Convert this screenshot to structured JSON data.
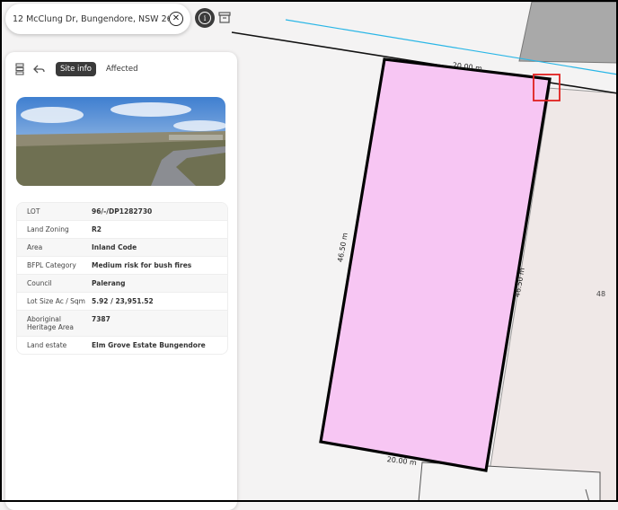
{
  "search": {
    "address": "12 McClung Dr, Bungendore, NSW 2621, A..."
  },
  "panel": {
    "tabs": [
      {
        "label": "Site info",
        "active": true
      },
      {
        "label": "Affected",
        "active": false
      }
    ],
    "rows": [
      {
        "label": "LOT",
        "value": "96/-/DP1282730"
      },
      {
        "label": "Land Zoning",
        "value": "R2"
      },
      {
        "label": "Area",
        "value": "Inland Code"
      },
      {
        "label": "BFPL Category",
        "value": "Medium risk for bush fires"
      },
      {
        "label": "Council",
        "value": "Palerang"
      },
      {
        "label": "Lot Size Ac / Sqm",
        "value": "5.92 / 23,951.52"
      },
      {
        "label": "Aboriginal Heritage Area",
        "value": "7387"
      },
      {
        "label": "Land estate",
        "value": "Elm Grove Estate Bungendore"
      }
    ]
  },
  "map": {
    "top_dimension": "20.00 m",
    "bottom_dimension": "20.00 m",
    "left_dimension": "46.50 m",
    "right_dimension": "46.50 m",
    "neighbour_lot": "48",
    "colors": {
      "lot_fill": "#f7c6f3",
      "line_cyan": "#29b6e6",
      "marker": "#e0201e"
    }
  }
}
